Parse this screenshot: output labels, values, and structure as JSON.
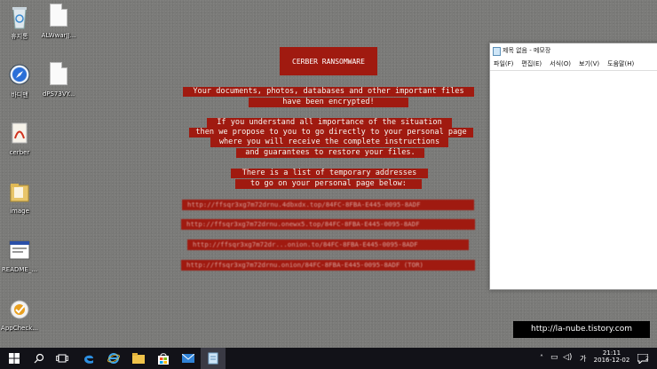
{
  "desktop": {
    "icons": [
      {
        "name": "recycle-bin",
        "label": "휴지통"
      },
      {
        "name": "alwwar-file",
        "label": "ALWwarJJ..."
      },
      {
        "name": "safari-shortcut",
        "label": "바디맨"
      },
      {
        "name": "dps-file",
        "label": "dPS73VY..."
      },
      {
        "name": "cerber-pdf",
        "label": "cerber"
      },
      {
        "name": "image-folder",
        "label": "image"
      },
      {
        "name": "readme-file",
        "label": "README_..."
      },
      {
        "name": "appcheck-app",
        "label": "AppCheck..."
      }
    ]
  },
  "ransom": {
    "title": "CERBER RANSOMWARE",
    "lines": [
      "Your documents, photos, databases and other important files",
      "have been encrypted!",
      "If you understand all importance of the situation",
      "then we propose to you to go directly to your personal page",
      "where you will receive the complete instructions",
      "and guarantees to restore your files.",
      "There is a list of temporary addresses",
      "to go on your personal page below:"
    ],
    "urls": [
      "http://ffsqr3xg7m72drnu.4dbxdx.top/84FC-8FBA-E445-0095-8ADF",
      "http://ffsqr3xg7m72drnu.onewx5.top/84FC-8FBA-E445-0095-8ADF",
      "http://ffsqr3xg7m72dr...onion.to/84FC-8FBA-E445-0095-8ADF",
      "http://ffsqr3xg7m72drnu.onion/84FC-8FBA-E445-0095-8ADF (TOR)"
    ]
  },
  "notepad": {
    "title": "제목 없음 - 메모장",
    "menu": [
      "파일(F)",
      "편집(E)",
      "서식(O)",
      "보기(V)",
      "도움말(H)"
    ]
  },
  "watermark": "http://la-nube.tistory.com",
  "taskbar": {
    "time": "21:11",
    "date": "2016-12-02",
    "ime": "가",
    "notifications": "2"
  },
  "colors": {
    "ransom_red": "#a01a10",
    "taskbar": "#121218",
    "desktop": "#7a7a78"
  }
}
